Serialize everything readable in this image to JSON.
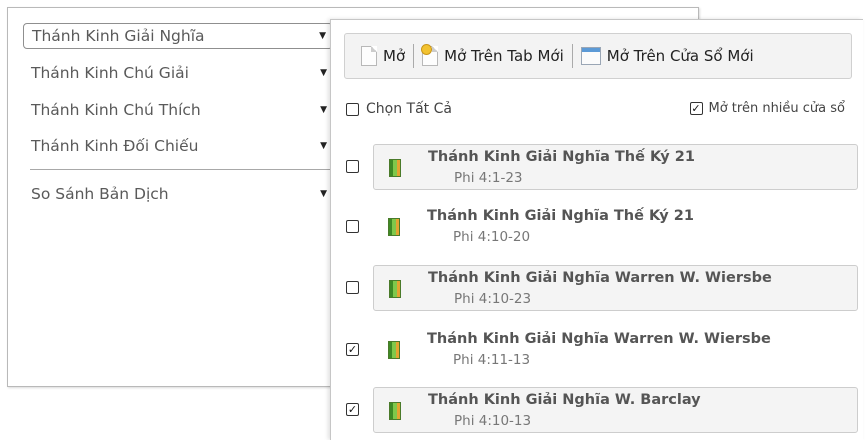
{
  "left_menu": {
    "items": [
      {
        "label": "Thánh Kinh Giải Nghĩa",
        "selected": true
      },
      {
        "label": "Thánh Kinh Chú Giải",
        "selected": false
      },
      {
        "label": "Thánh Kinh Chú Thích",
        "selected": false
      },
      {
        "label": "Thánh Kinh Đối Chiếu",
        "selected": false
      },
      {
        "label": "So Sánh Bản Dịch",
        "selected": false
      }
    ]
  },
  "toolbar": {
    "open_label": "Mở",
    "open_tab_label": "Mở Trên Tab Mới",
    "open_window_label": "Mở Trên Cửa Sổ Mới"
  },
  "options": {
    "select_all_label": "Chọn Tất Cả",
    "select_all_checked": false,
    "multi_window_label": "Mở trên nhiều cửa sổ",
    "multi_window_checked": true
  },
  "books": [
    {
      "title": "Thánh Kinh Giải Nghĩa Thế Ký 21",
      "ref": "Phi 4:1-23",
      "checked": false
    },
    {
      "title": "Thánh Kinh Giải Nghĩa Thế Ký 21",
      "ref": "Phi 4:10-20",
      "checked": false
    },
    {
      "title": "Thánh Kinh Giải Nghĩa Warren W. Wiersbe",
      "ref": "Phi 4:10-23",
      "checked": false
    },
    {
      "title": "Thánh Kinh Giải Nghĩa Warren W. Wiersbe",
      "ref": "Phi 4:11-13",
      "checked": true
    },
    {
      "title": "Thánh Kinh Giải Nghĩa W. Barclay",
      "ref": "Phi 4:10-13",
      "checked": true
    }
  ],
  "colors": {
    "book_icon_green": "#7fc84b",
    "tab_icon_yellow": "#f2c230",
    "window_icon_blue": "#5c9ad6"
  }
}
